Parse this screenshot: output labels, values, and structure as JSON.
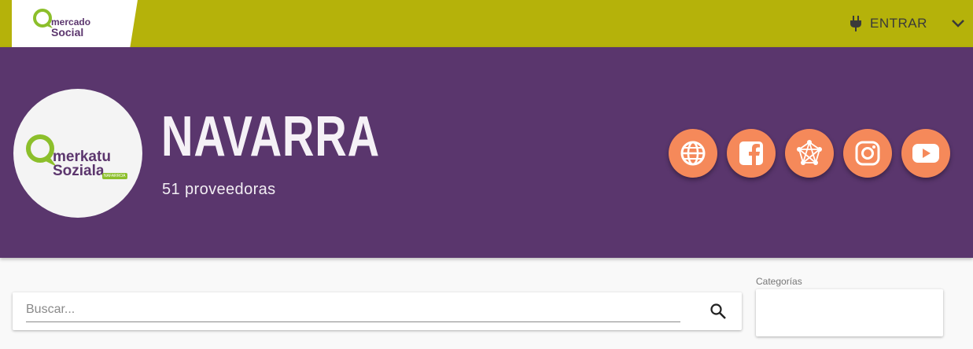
{
  "header": {
    "logo_line1": "mercado",
    "logo_line2": "Social",
    "login_label": "ENTRAR",
    "login_icon": "plug-icon",
    "menu_icon": "chevron-down-icon"
  },
  "hero": {
    "logo_line1": "merkatu",
    "logo_line2": "Soziala",
    "logo_tag": "NAFARROA",
    "title": "NAVARRA",
    "subtitle": "51 proveedoras",
    "social_links": [
      {
        "name": "website",
        "icon": "globe-icon"
      },
      {
        "name": "facebook",
        "icon": "facebook-icon"
      },
      {
        "name": "network",
        "icon": "network-icon"
      },
      {
        "name": "instagram",
        "icon": "instagram-icon"
      },
      {
        "name": "youtube",
        "icon": "youtube-icon"
      }
    ],
    "accent_color": "#f5895a",
    "background_color": "#5a366d"
  },
  "filters": {
    "search_placeholder": "Buscar...",
    "search_value": "",
    "categories_label": "Categorías",
    "categories_value": ""
  },
  "colors": {
    "topbar": "#b5b20a",
    "brand_purple": "#5c366e",
    "brand_green": "#8cbf2b"
  }
}
